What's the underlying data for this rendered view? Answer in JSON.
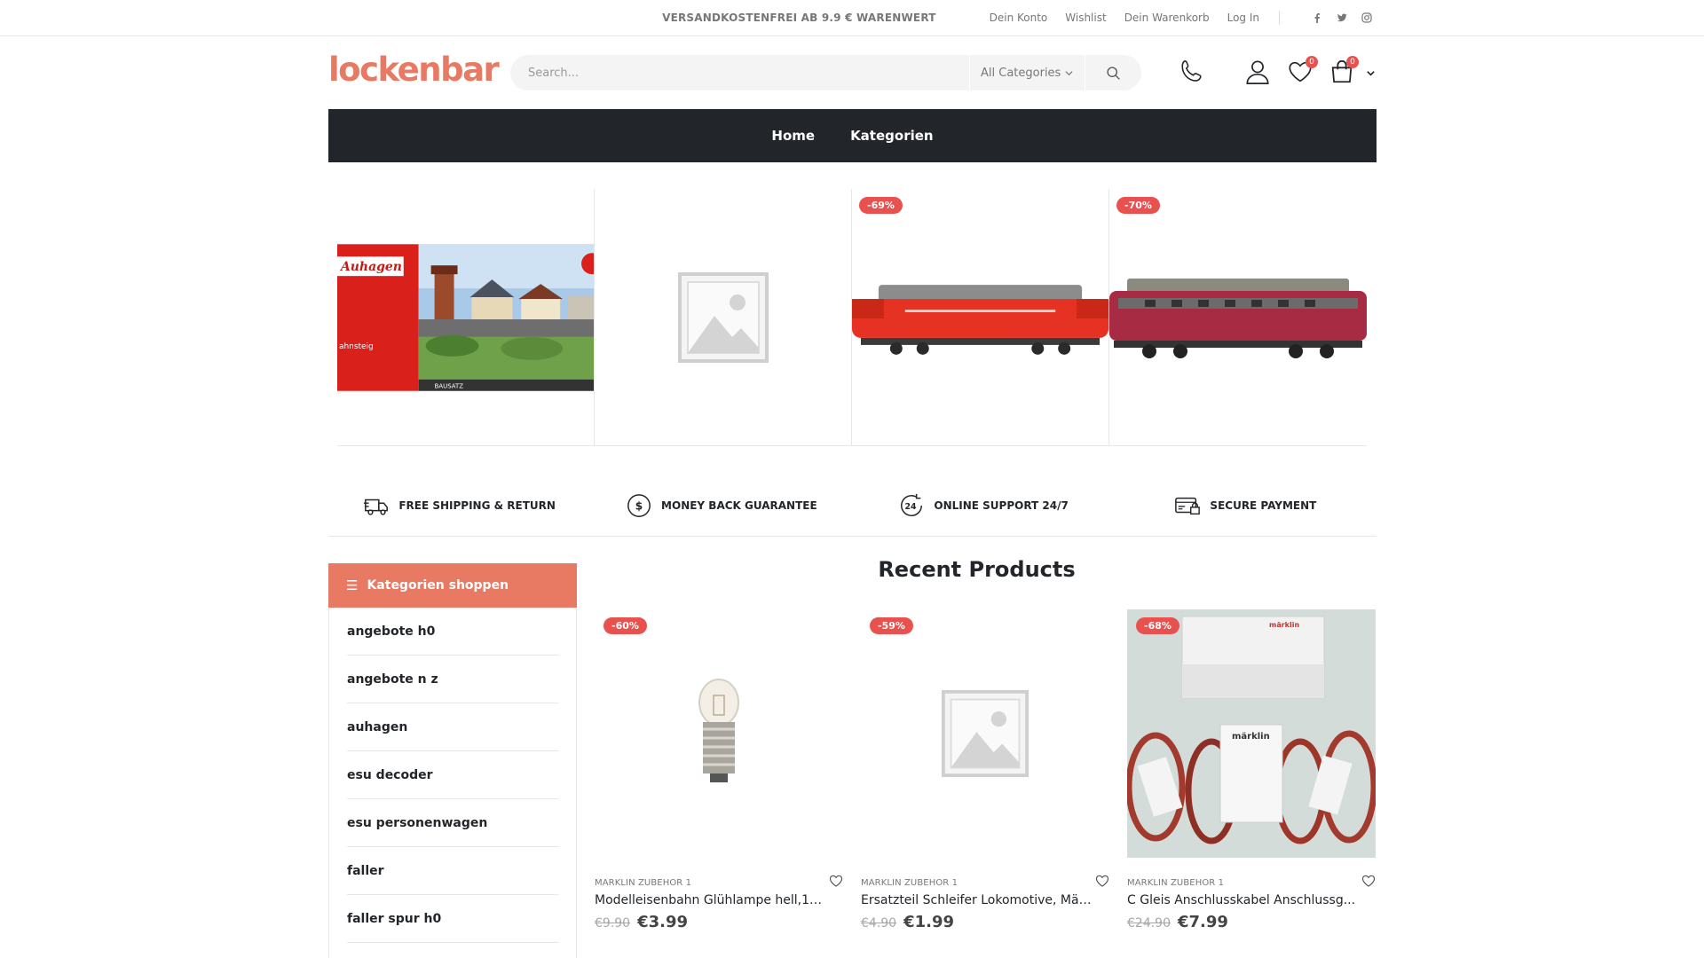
{
  "topbar": {
    "promo": "VERSANDKOSTENFREI AB 9.9 € WARENWERT",
    "links": [
      "Dein Konto",
      "Wishlist",
      "Dein Warenkorb",
      "Log In"
    ],
    "social_icons": [
      "facebook-icon",
      "twitter-icon",
      "instagram-icon"
    ]
  },
  "header": {
    "logo": "lockenbar",
    "search_placeholder": "Search...",
    "category_select": "All Categories",
    "wishlist_count": "0",
    "cart_count": "0"
  },
  "nav": {
    "items": [
      "Home",
      "Kategorien"
    ]
  },
  "banner": {
    "products": [
      {
        "discount": "",
        "image": "auhagen-box"
      },
      {
        "discount": "",
        "image": "placeholder"
      },
      {
        "discount": "-69%",
        "image": "red-locomotive"
      },
      {
        "discount": "-70%",
        "image": "dark-red-locomotive"
      }
    ]
  },
  "features": [
    {
      "label": "FREE SHIPPING & RETURN",
      "icon": "truck-icon"
    },
    {
      "label": "MONEY BACK GUARANTEE",
      "icon": "dollar-circle-icon"
    },
    {
      "label": "ONLINE SUPPORT 24/7",
      "icon": "support-24-icon"
    },
    {
      "label": "SECURE PAYMENT",
      "icon": "secure-card-icon"
    }
  ],
  "sidebar": {
    "title": "Kategorien shoppen",
    "items": [
      "angebote h0",
      "angebote n z",
      "auhagen",
      "esu decoder",
      "esu personenwagen",
      "faller",
      "faller spur h0"
    ]
  },
  "recent": {
    "title": "Recent Products",
    "products": [
      {
        "discount": "-60%",
        "category": "MARKLIN ZUBEHOR 1",
        "title": "Modelleisenbahn Glühlampe hell,19...",
        "old_price": "€9.90",
        "price": "€3.99",
        "image": "bulb"
      },
      {
        "discount": "-59%",
        "category": "MARKLIN ZUBEHOR 1",
        "title": "Ersatzteil Schleifer Lokomotive, Märk...",
        "old_price": "€4.90",
        "price": "€1.99",
        "image": "placeholder"
      },
      {
        "discount": "-68%",
        "category": "MARKLIN ZUBEHOR 1",
        "title": "C Gleis Anschlusskabel Anschlussg...",
        "old_price": "€24.90",
        "price": "€7.99",
        "image": "cables"
      }
    ]
  },
  "colors": {
    "accent": "#e87a64",
    "discount": "#e9514f",
    "dark": "#222529"
  }
}
